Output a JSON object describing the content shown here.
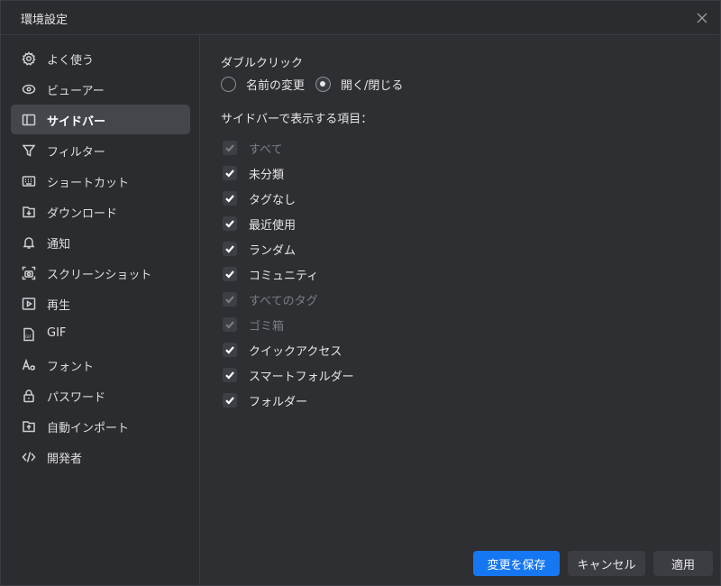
{
  "window": {
    "title": "環境設定"
  },
  "sidebar": {
    "items": [
      {
        "label": "よく使う",
        "icon": "gear-icon"
      },
      {
        "label": "ビューアー",
        "icon": "eye-icon"
      },
      {
        "label": "サイドバー",
        "icon": "sidebar-icon",
        "active": true
      },
      {
        "label": "フィルター",
        "icon": "filter-icon"
      },
      {
        "label": "ショートカット",
        "icon": "keyboard-icon"
      },
      {
        "label": "ダウンロード",
        "icon": "download-icon"
      },
      {
        "label": "通知",
        "icon": "bell-icon"
      },
      {
        "label": "スクリーンショット",
        "icon": "screenshot-icon"
      },
      {
        "label": "再生",
        "icon": "play-icon"
      },
      {
        "label": "GIF",
        "icon": "gif-icon"
      },
      {
        "label": "フォント",
        "icon": "font-icon"
      },
      {
        "label": "パスワード",
        "icon": "lock-icon"
      },
      {
        "label": "自動インポート",
        "icon": "import-icon"
      },
      {
        "label": "開発者",
        "icon": "code-icon"
      }
    ]
  },
  "double_click": {
    "label": "ダブルクリック",
    "options": [
      {
        "label": "名前の変更",
        "checked": false
      },
      {
        "label": "開く/閉じる",
        "checked": true
      }
    ]
  },
  "sidebar_items": {
    "label": "サイドバーで表示する項目：",
    "items": [
      {
        "label": "すべて",
        "checked": true,
        "disabled": true
      },
      {
        "label": "未分類",
        "checked": true,
        "disabled": false
      },
      {
        "label": "タグなし",
        "checked": true,
        "disabled": false
      },
      {
        "label": "最近使用",
        "checked": true,
        "disabled": false
      },
      {
        "label": "ランダム",
        "checked": true,
        "disabled": false
      },
      {
        "label": "コミュニティ",
        "checked": true,
        "disabled": false
      },
      {
        "label": "すべてのタグ",
        "checked": true,
        "disabled": true
      },
      {
        "label": "ゴミ箱",
        "checked": true,
        "disabled": true
      },
      {
        "label": "クイックアクセス",
        "checked": true,
        "disabled": false
      },
      {
        "label": "スマートフォルダー",
        "checked": true,
        "disabled": false
      },
      {
        "label": "フォルダー",
        "checked": true,
        "disabled": false
      }
    ]
  },
  "footer": {
    "save_label": "変更を保存",
    "cancel_label": "キャンセル",
    "apply_label": "適用"
  },
  "colors": {
    "accent": "#1677f2",
    "active_item": "#45464c",
    "background": "#2e2f33"
  }
}
